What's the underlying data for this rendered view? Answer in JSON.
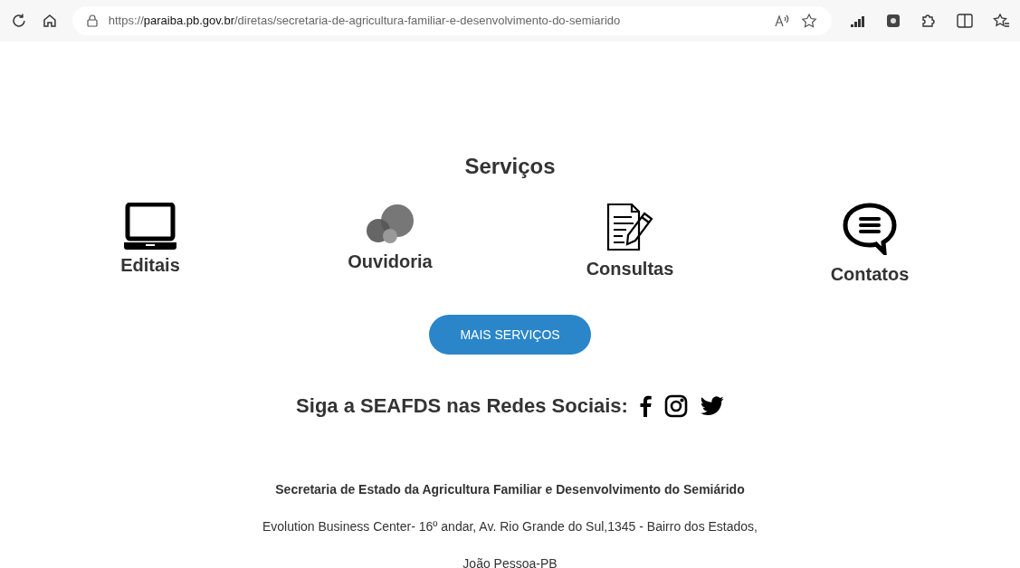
{
  "browser": {
    "url_scheme": "https://",
    "url_host": "paraiba.pb.gov.br",
    "url_path": "/diretas/secretaria-de-agricultura-familiar-e-desenvolvimento-do-semiarido"
  },
  "services": {
    "title": "Serviços",
    "items": [
      {
        "kind": "laptop",
        "label": "Editais"
      },
      {
        "kind": "bubbles",
        "label": "Ouvidoria"
      },
      {
        "kind": "document",
        "label": "Consultas"
      },
      {
        "kind": "chat",
        "label": "Contatos"
      }
    ],
    "more_button": "MAIS SERVIÇOS"
  },
  "social": {
    "label": "Siga a SEAFDS nas Redes Sociais:",
    "networks": [
      {
        "kind": "facebook"
      },
      {
        "kind": "instagram"
      },
      {
        "kind": "twitter"
      }
    ]
  },
  "footer": {
    "name": "Secretaria de Estado da Agricultura Familiar e Desenvolvimento do Semiárido",
    "address": "Evolution Business Center- 16º andar, Av. Rio Grande do Sul,1345 - Bairro dos Estados,",
    "city": "João Pessoa-PB"
  }
}
